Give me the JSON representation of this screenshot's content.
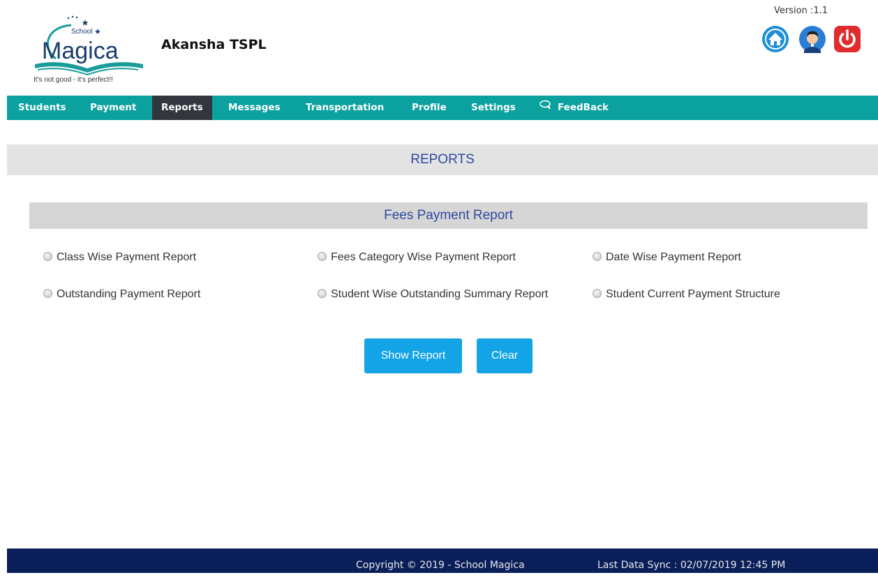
{
  "header": {
    "logo_small": "School",
    "logo_text": "Magica",
    "tagline": "It's not good - it's perfect!!",
    "school_name": "Akansha TSPL",
    "version": "Version :1.1"
  },
  "icons": {
    "home": "home-icon",
    "profile": "user-avatar-icon",
    "logout": "power-icon",
    "feedback": "chat-bubble-icon"
  },
  "colors": {
    "nav_bg": "#0aa19e",
    "nav_active": "#33363e",
    "title_text": "#2e4aa0",
    "button": "#12a4e6",
    "footer_bg": "#0a1f5a"
  },
  "nav": {
    "items": [
      {
        "label": "Students"
      },
      {
        "label": "Payment"
      },
      {
        "label": "Reports",
        "active": true
      },
      {
        "label": "Messages"
      },
      {
        "label": "Transportation"
      },
      {
        "label": "Profile"
      },
      {
        "label": "Settings"
      },
      {
        "label": "FeedBack"
      }
    ]
  },
  "page_title": "REPORTS",
  "section": {
    "title": "Fees Payment Report",
    "options": [
      {
        "label": "Class Wise Payment Report",
        "selected": false
      },
      {
        "label": "Fees Category Wise Payment Report",
        "selected": false
      },
      {
        "label": "Date Wise Payment Report",
        "selected": false
      },
      {
        "label": "Outstanding Payment Report",
        "selected": false
      },
      {
        "label": "Student Wise Outstanding Summary Report",
        "selected": false
      },
      {
        "label": "Student Current Payment Structure",
        "selected": false
      }
    ]
  },
  "buttons": {
    "show_report": "Show Report",
    "clear": "Clear"
  },
  "footer": {
    "copyright": "Copyright © 2019 - School Magica",
    "last_sync": "Last Data Sync : 02/07/2019 12:45 PM"
  }
}
